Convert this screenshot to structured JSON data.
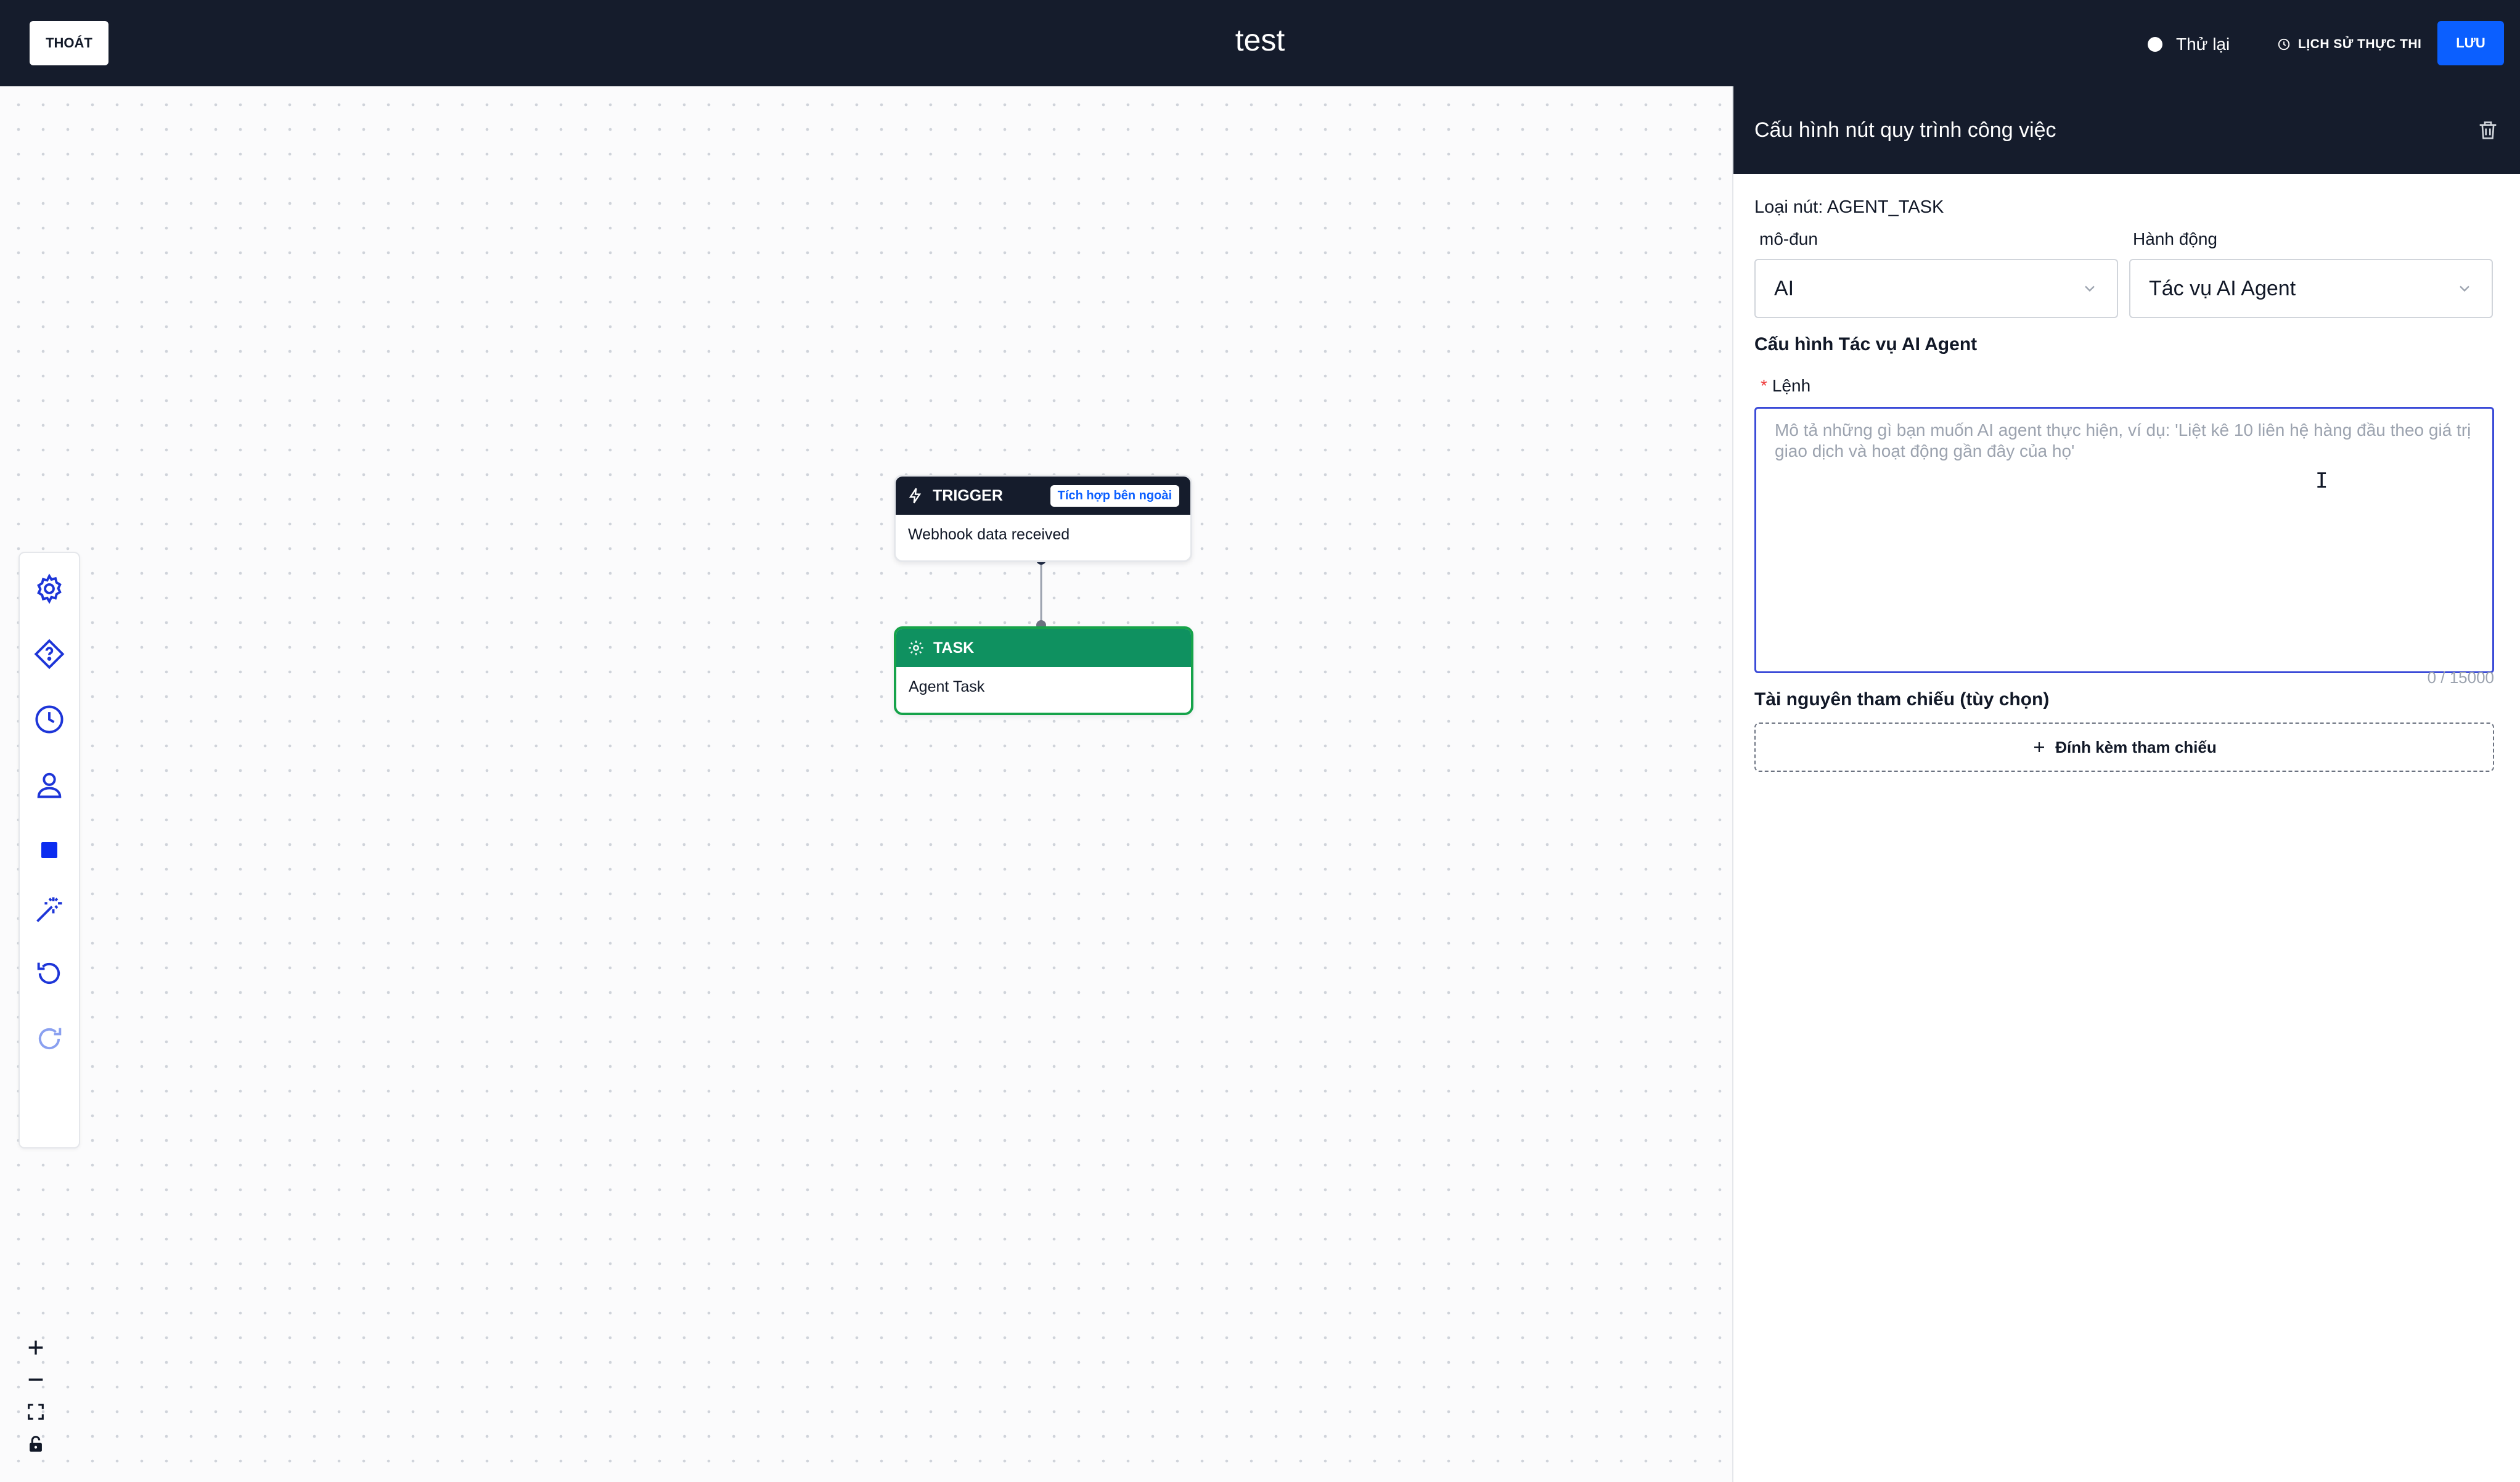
{
  "topbar": {
    "exit_label": "THOÁT",
    "title": "test",
    "retry_label": "Thử lại",
    "history_label": "LỊCH SỬ THỰC THI",
    "save_label": "LƯU"
  },
  "toolbar": {
    "tools": [
      "gear-icon",
      "diamond-question-icon",
      "clock-icon",
      "person-icon",
      "square-icon",
      "magic-wand-icon",
      "undo-icon",
      "redo-icon"
    ]
  },
  "zoom": [
    "plus-icon",
    "minus-icon",
    "fit-view-icon",
    "lock-icon"
  ],
  "nodes": {
    "trigger": {
      "header": "TRIGGER",
      "badge": "Tích hợp bên ngoài",
      "body": "Webhook data received"
    },
    "task": {
      "header": "TASK",
      "body": "Agent Task"
    }
  },
  "panel": {
    "title": "Cấu hình nút quy trình công việc",
    "node_type": "Loại nút: AGENT_TASK",
    "module_label": "mô-đun",
    "module_value": "AI",
    "action_label": "Hành động",
    "action_value": "Tác vụ AI Agent",
    "section_title": "Cấu hình Tác vụ AI Agent",
    "prompt_label": "Lệnh",
    "prompt_placeholder": "Mô tả những gì bạn muốn AI agent thực hiện, ví dụ: 'Liệt kê 10 liên hệ hàng đầu theo giá trị giao dịch và hoạt động gần đây của họ'",
    "prompt_value": "",
    "counter": "0 / 15000",
    "references_title": "Tài nguyên tham chiếu (tùy chọn)",
    "attach_label": "Đính kèm tham chiếu"
  },
  "colors": {
    "topbar_bg": "#151c2c",
    "primary": "#0b5fff",
    "task_green": "#0f9160",
    "tool_blue": "#1d35d8"
  }
}
